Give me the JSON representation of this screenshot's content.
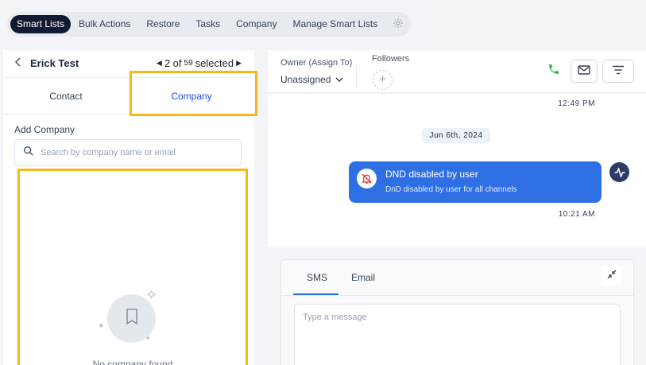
{
  "topnav": {
    "tabs": [
      "Smart Lists",
      "Bulk Actions",
      "Restore",
      "Tasks",
      "Company",
      "Manage Smart Lists"
    ],
    "active_tab": "Smart Lists",
    "settings_icon": "gear-icon"
  },
  "contact": {
    "name": "Erick Test",
    "pager_text": "2 of",
    "pager_total": "59",
    "pager_suffix": "selected"
  },
  "subtabs": {
    "contact": "Contact",
    "company": "Company",
    "active": "Company"
  },
  "company_panel": {
    "add_label": "Add Company",
    "search_placeholder": "Search by company name or email",
    "empty_text": "No company found"
  },
  "header": {
    "owner_label": "Owner (Assign To)",
    "owner_value": "Unassigned",
    "followers_label": "Followers",
    "colors": {
      "phone": "#22c55e",
      "accent": "#2f6fe4"
    }
  },
  "conversation": {
    "time_1": "12:49 PM",
    "date_chip": "Jun 6th, 2024",
    "event_title": "DND disabled by user",
    "event_subtitle": "DnD disabled by user for all channels",
    "time_2": "10:21 AM"
  },
  "composer": {
    "tab_sms": "SMS",
    "tab_email": "Email",
    "active_tab": "SMS",
    "message_placeholder": "Type a message"
  }
}
